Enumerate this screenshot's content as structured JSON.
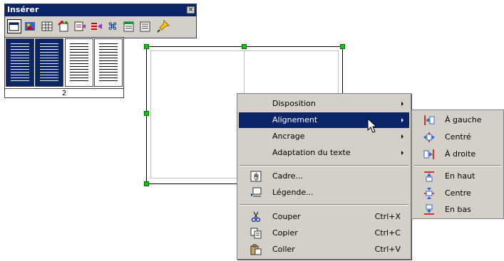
{
  "toolbar": {
    "title": "Insérer",
    "close": "×",
    "buttons": [
      {
        "name": "frame-icon"
      },
      {
        "name": "image-icon"
      },
      {
        "name": "table-icon"
      },
      {
        "name": "fields-icon"
      },
      {
        "name": "section-icon"
      },
      {
        "name": "text-frame-icon"
      },
      {
        "name": "special-char-icon"
      },
      {
        "name": "document-icon"
      },
      {
        "name": "list-icon"
      },
      {
        "name": "insert-pin-icon"
      }
    ]
  },
  "columns_picker": {
    "count": "2"
  },
  "context_menu": {
    "items": [
      {
        "label": "Disposition",
        "accel": "D"
      },
      {
        "label": "Alignement",
        "accel": "l"
      },
      {
        "label": "Ancrage",
        "accel": "A"
      },
      {
        "label": "Adaptation du texte",
        "accel": "A"
      },
      {
        "label": "Cadre...",
        "accel": "C"
      },
      {
        "label": "Légende...",
        "accel": "L"
      },
      {
        "label": "Couper",
        "accel": "C",
        "shortcut": "Ctrl+X"
      },
      {
        "label": "Copier",
        "accel": "i",
        "shortcut": "Ctrl+C"
      },
      {
        "label": "Coller",
        "accel": "o",
        "shortcut": "Ctrl+V"
      }
    ]
  },
  "alignment_submenu": {
    "items": [
      {
        "label": "À gauche"
      },
      {
        "label": "Centré"
      },
      {
        "label": "À droite"
      },
      {
        "label": "En haut"
      },
      {
        "label": "Centre"
      },
      {
        "label": "En bas"
      }
    ]
  }
}
